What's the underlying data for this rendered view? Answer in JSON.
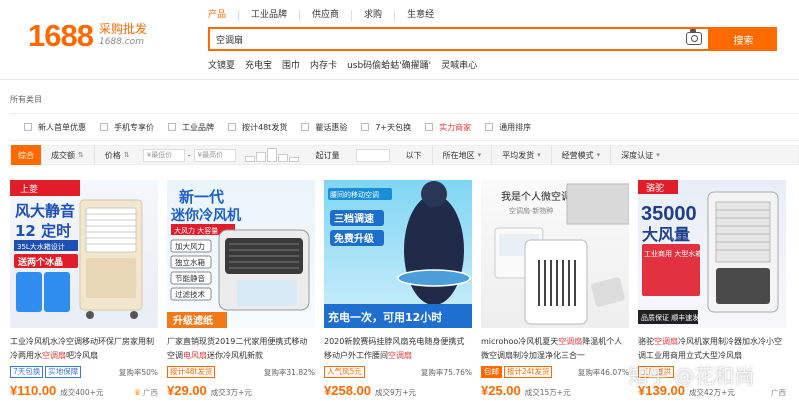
{
  "logo": {
    "brand": "1688",
    "tagline": "采购批发",
    "site": "1688.com"
  },
  "search_tabs": [
    "产品",
    "工业品牌",
    "供应商",
    "求购",
    "生意经"
  ],
  "search": {
    "value": "空调扇",
    "button": "搜索"
  },
  "hot_words": [
    "文镜夏",
    "充电宝",
    "围巾",
    "内存卡",
    "usb码偷蛤蛄'确擢踊'",
    "灵喊串心"
  ],
  "breadcrumb": "所有类目",
  "features": [
    {
      "label": "新人首单优惠",
      "highlight": false
    },
    {
      "label": "手机专享价",
      "highlight": false
    },
    {
      "label": "工业品牌",
      "highlight": false
    },
    {
      "label": "按计48t发货",
      "highlight": false
    },
    {
      "label": "瞿话惠验",
      "highlight": false
    },
    {
      "label": "7+天包换",
      "highlight": false
    },
    {
      "label": "实力商家",
      "highlight": true
    },
    {
      "label": "通用排序",
      "highlight": false
    }
  ],
  "sortbar": {
    "active": "综合",
    "sales": "成交额",
    "price": "价格",
    "price_min": "¥最低价",
    "price_sep": "-",
    "price_max": "¥最高价",
    "qty": "起订量",
    "qty_suffix": "以下",
    "location": "所在地区",
    "avg_ship": "平均发货",
    "mode": "经营模式",
    "cert": "深度认证"
  },
  "products": [
    {
      "title_pre": "工业冷风机水冷空调移动环保厂房家用制冷两用水",
      "title_hl": "空调扇",
      "title_post": "吧冷风扇",
      "badges": [
        {
          "text": "7天包换",
          "style": "blue"
        },
        {
          "text": "实地保障",
          "style": "blue"
        }
      ],
      "rate": "复购率50%",
      "price": "¥110.00",
      "sold": "成交400+元",
      "loc": "广西",
      "img": {
        "brand": "上菱",
        "line1": "风大静音",
        "line2": "12 定时",
        "line3": "35L大水箱设计",
        "line4": "送两个冰晶"
      }
    },
    {
      "title_pre": "厂家直销现货2019二代家用便携式移动空调",
      "title_hl": "电风扇",
      "title_post": "迷你冷风机新款",
      "badges": [
        {
          "text": "按计48t发货",
          "style": "orange"
        }
      ],
      "rate": "复购率31.82%",
      "price": "¥29.00",
      "sold": "成交3万+元",
      "loc": "",
      "img": {
        "line1": "新一代",
        "line2": "迷你冷风机",
        "line3": "大风力 大容量",
        "feats": [
          "加大风力",
          "独立水箱",
          "节能静音",
          "过滤技术"
        ],
        "line4": "升级滤纸"
      }
    },
    {
      "title_pre": "2020新款赛码挂脖风扇充电随身便携式移动户外工作腰间",
      "title_hl": "空调扇",
      "title_post": "",
      "badges": [
        {
          "text": "人气风5元",
          "style": "orange"
        }
      ],
      "rate": "复购率75.76%",
      "price": "¥258.00",
      "sold": "成交9万+元",
      "loc": "",
      "img": {
        "line1": "腰间的移动空调",
        "line2": "三档调速",
        "line3": "免费升级",
        "line4": "充电一次，可用12小时"
      }
    },
    {
      "title_pre": "microhoo冷风机夏天",
      "title_hl": "空调扇",
      "title_post": "降温机个人微空调扇制冷加湿净化三合一",
      "badges": [
        {
          "text": "包邮",
          "style": "fill"
        },
        {
          "text": "按计24t发货",
          "style": "orange"
        }
      ],
      "rate": "复购率46.07%",
      "price": "¥25.00",
      "sold": "成交15万+元",
      "loc": "",
      "img": {
        "line1": "我是个人微空调",
        "line2": "空调扇·新物种"
      }
    },
    {
      "title_pre": "骆驼",
      "title_hl": "空调扇",
      "title_post": "冷风机家用制冷器加水冷小空调工业用商用立式大型冷风扇",
      "badges": [
        {
          "text": "工厂直供",
          "style": "orange"
        }
      ],
      "rate": "",
      "price": "¥139.00",
      "sold": "成交42万+元",
      "loc": "广西",
      "img": {
        "brand": "骆驼",
        "line1": "35000",
        "line2": "大风量",
        "line3": "工业商用 大型水箱",
        "line4": "品质保证 顺丰速发"
      }
    }
  ],
  "watermark": "知乎 @花和尚",
  "colors": {
    "accent": "#ff6a00",
    "highlight": "#e4393c"
  }
}
